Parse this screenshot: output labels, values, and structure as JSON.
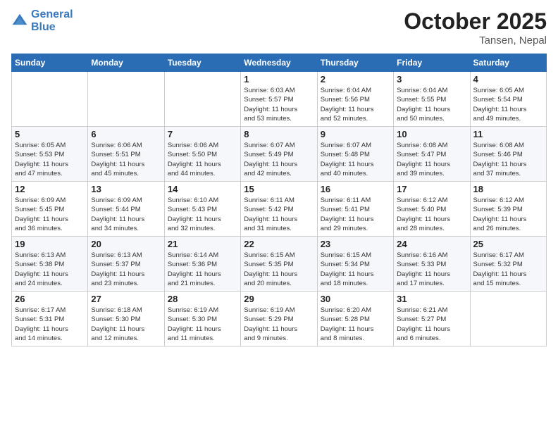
{
  "header": {
    "logo_line1": "General",
    "logo_line2": "Blue",
    "month": "October 2025",
    "location": "Tansen, Nepal"
  },
  "weekdays": [
    "Sunday",
    "Monday",
    "Tuesday",
    "Wednesday",
    "Thursday",
    "Friday",
    "Saturday"
  ],
  "weeks": [
    [
      {
        "day": "",
        "info": ""
      },
      {
        "day": "",
        "info": ""
      },
      {
        "day": "",
        "info": ""
      },
      {
        "day": "1",
        "info": "Sunrise: 6:03 AM\nSunset: 5:57 PM\nDaylight: 11 hours\nand 53 minutes."
      },
      {
        "day": "2",
        "info": "Sunrise: 6:04 AM\nSunset: 5:56 PM\nDaylight: 11 hours\nand 52 minutes."
      },
      {
        "day": "3",
        "info": "Sunrise: 6:04 AM\nSunset: 5:55 PM\nDaylight: 11 hours\nand 50 minutes."
      },
      {
        "day": "4",
        "info": "Sunrise: 6:05 AM\nSunset: 5:54 PM\nDaylight: 11 hours\nand 49 minutes."
      }
    ],
    [
      {
        "day": "5",
        "info": "Sunrise: 6:05 AM\nSunset: 5:53 PM\nDaylight: 11 hours\nand 47 minutes."
      },
      {
        "day": "6",
        "info": "Sunrise: 6:06 AM\nSunset: 5:51 PM\nDaylight: 11 hours\nand 45 minutes."
      },
      {
        "day": "7",
        "info": "Sunrise: 6:06 AM\nSunset: 5:50 PM\nDaylight: 11 hours\nand 44 minutes."
      },
      {
        "day": "8",
        "info": "Sunrise: 6:07 AM\nSunset: 5:49 PM\nDaylight: 11 hours\nand 42 minutes."
      },
      {
        "day": "9",
        "info": "Sunrise: 6:07 AM\nSunset: 5:48 PM\nDaylight: 11 hours\nand 40 minutes."
      },
      {
        "day": "10",
        "info": "Sunrise: 6:08 AM\nSunset: 5:47 PM\nDaylight: 11 hours\nand 39 minutes."
      },
      {
        "day": "11",
        "info": "Sunrise: 6:08 AM\nSunset: 5:46 PM\nDaylight: 11 hours\nand 37 minutes."
      }
    ],
    [
      {
        "day": "12",
        "info": "Sunrise: 6:09 AM\nSunset: 5:45 PM\nDaylight: 11 hours\nand 36 minutes."
      },
      {
        "day": "13",
        "info": "Sunrise: 6:09 AM\nSunset: 5:44 PM\nDaylight: 11 hours\nand 34 minutes."
      },
      {
        "day": "14",
        "info": "Sunrise: 6:10 AM\nSunset: 5:43 PM\nDaylight: 11 hours\nand 32 minutes."
      },
      {
        "day": "15",
        "info": "Sunrise: 6:11 AM\nSunset: 5:42 PM\nDaylight: 11 hours\nand 31 minutes."
      },
      {
        "day": "16",
        "info": "Sunrise: 6:11 AM\nSunset: 5:41 PM\nDaylight: 11 hours\nand 29 minutes."
      },
      {
        "day": "17",
        "info": "Sunrise: 6:12 AM\nSunset: 5:40 PM\nDaylight: 11 hours\nand 28 minutes."
      },
      {
        "day": "18",
        "info": "Sunrise: 6:12 AM\nSunset: 5:39 PM\nDaylight: 11 hours\nand 26 minutes."
      }
    ],
    [
      {
        "day": "19",
        "info": "Sunrise: 6:13 AM\nSunset: 5:38 PM\nDaylight: 11 hours\nand 24 minutes."
      },
      {
        "day": "20",
        "info": "Sunrise: 6:13 AM\nSunset: 5:37 PM\nDaylight: 11 hours\nand 23 minutes."
      },
      {
        "day": "21",
        "info": "Sunrise: 6:14 AM\nSunset: 5:36 PM\nDaylight: 11 hours\nand 21 minutes."
      },
      {
        "day": "22",
        "info": "Sunrise: 6:15 AM\nSunset: 5:35 PM\nDaylight: 11 hours\nand 20 minutes."
      },
      {
        "day": "23",
        "info": "Sunrise: 6:15 AM\nSunset: 5:34 PM\nDaylight: 11 hours\nand 18 minutes."
      },
      {
        "day": "24",
        "info": "Sunrise: 6:16 AM\nSunset: 5:33 PM\nDaylight: 11 hours\nand 17 minutes."
      },
      {
        "day": "25",
        "info": "Sunrise: 6:17 AM\nSunset: 5:32 PM\nDaylight: 11 hours\nand 15 minutes."
      }
    ],
    [
      {
        "day": "26",
        "info": "Sunrise: 6:17 AM\nSunset: 5:31 PM\nDaylight: 11 hours\nand 14 minutes."
      },
      {
        "day": "27",
        "info": "Sunrise: 6:18 AM\nSunset: 5:30 PM\nDaylight: 11 hours\nand 12 minutes."
      },
      {
        "day": "28",
        "info": "Sunrise: 6:19 AM\nSunset: 5:30 PM\nDaylight: 11 hours\nand 11 minutes."
      },
      {
        "day": "29",
        "info": "Sunrise: 6:19 AM\nSunset: 5:29 PM\nDaylight: 11 hours\nand 9 minutes."
      },
      {
        "day": "30",
        "info": "Sunrise: 6:20 AM\nSunset: 5:28 PM\nDaylight: 11 hours\nand 8 minutes."
      },
      {
        "day": "31",
        "info": "Sunrise: 6:21 AM\nSunset: 5:27 PM\nDaylight: 11 hours\nand 6 minutes."
      },
      {
        "day": "",
        "info": ""
      }
    ]
  ]
}
